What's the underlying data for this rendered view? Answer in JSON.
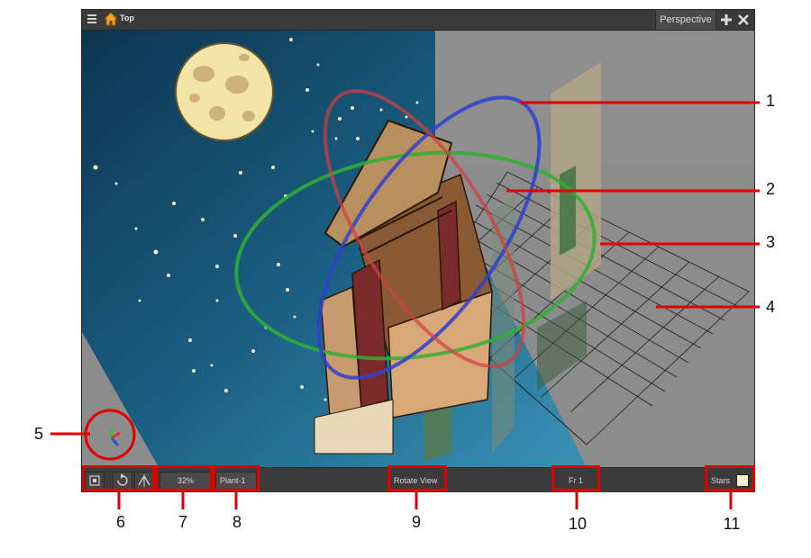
{
  "window": {
    "breadcrumb": "Top",
    "view_tab": "Perspective"
  },
  "bottom_bar": {
    "zoom": "32%",
    "element": "Plant-1",
    "tool_status": "Rotate View",
    "frame": "Fr 1",
    "layer": "Stars"
  },
  "callouts": [
    "1",
    "2",
    "3",
    "4",
    "5",
    "6",
    "7",
    "8",
    "9",
    "10",
    "11"
  ],
  "colors": {
    "callout": "#e00000",
    "sky": "#1f5f86",
    "rotate_x": "#e04040",
    "rotate_y": "#30b030",
    "rotate_z": "#3040d0"
  },
  "icons": [
    "menu-icon",
    "home-icon",
    "add-view-icon",
    "close-icon",
    "reset-view-icon",
    "rotate-view-reset-icon",
    "flip-icon",
    "axis-gizmo-icon"
  ]
}
